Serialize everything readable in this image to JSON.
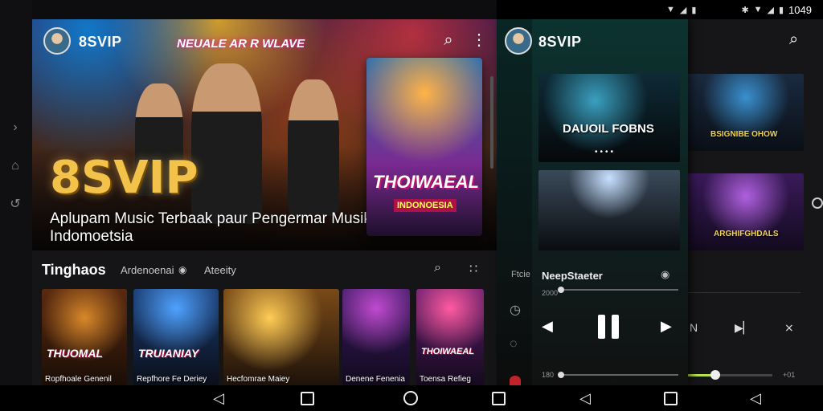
{
  "status_bar": {
    "time": "1049"
  },
  "main": {
    "brand": "8SVIP",
    "hero": {
      "banner": "NEUALE AR R WLAVE",
      "logo": "8SVIP",
      "description": "Aplupam Music Terbaak paur Pengermar Musik Indomoetsia",
      "poster_title": "THOIWAEAL",
      "poster_subtitle": "INDONOESIA"
    },
    "section": {
      "title": "Tinghaos",
      "link_1": "Ardenoenai",
      "link_2": "Ateeity"
    },
    "tiles": [
      {
        "label": "Ropfhoale Genenil",
        "art": "THUOMAL"
      },
      {
        "label": "Repfhore Fe Deriey",
        "art": "TRUIANIAY"
      },
      {
        "label": "Hecfomrae Maiey",
        "art": ""
      },
      {
        "label": "Denene Fenenia",
        "art": ""
      },
      {
        "label": "Toensa Refieg",
        "art": "THOIWAEAL"
      }
    ]
  },
  "player": {
    "brand": "8SVIP",
    "cards": [
      {
        "title": "DAUOIL FOBNS"
      },
      {
        "title": ""
      }
    ],
    "side_label": "Ftcie",
    "now_playing": "NeepStaeter",
    "time_top": "2000",
    "time_bottom": "180"
  },
  "right_bg": {
    "cards": [
      {
        "title": "BSIGNIBE OHOW"
      },
      {
        "title": "ARGHIFGHDALS"
      }
    ],
    "time_end": "+01",
    "letter": "N"
  },
  "colors": {
    "accent": "#b8e34a",
    "gold": "#f2c24a",
    "drawer": "#0c3330"
  }
}
